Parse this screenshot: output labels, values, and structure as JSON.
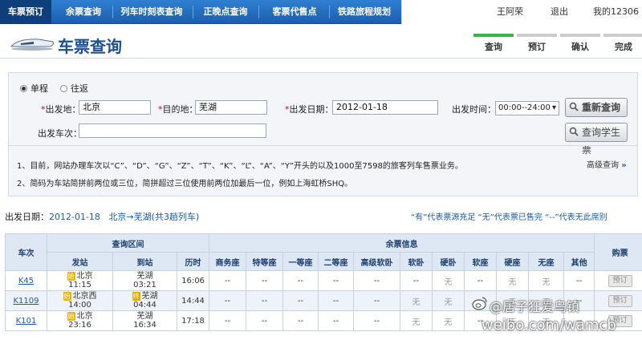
{
  "nav": {
    "items": [
      "车票预订",
      "余票查询",
      "列车时刻表查询",
      "正晚点查询",
      "客票代售点",
      "铁路旅程规划"
    ],
    "user_name": "王阿荣",
    "logout": "退出",
    "my12306": "我的12306"
  },
  "header": {
    "title": "车票查询",
    "steps": [
      "查询",
      "预订",
      "确认",
      "完成"
    ]
  },
  "form": {
    "trip_oneway": "单程",
    "trip_round": "往返",
    "from_label": "出发地：",
    "from_value": "北京",
    "to_label": "目的地：",
    "to_value": "芜湖",
    "date_label": "出发日期：",
    "date_value": "2012-01-18",
    "time_label": "出发时间：",
    "time_value": "00:00--24:00",
    "train_label": "出发车次：",
    "train_value": "",
    "required_mark": "*",
    "search_button": "重新查询",
    "student_button": "查询学生票",
    "notes": [
      "1、目前，网站办理车次以“C”、“D”、“G”、“Z”、“T”、“K”、“L”、“A”、“Y”开头的以及1000至7598的旅客列车售票业务。",
      "2、简码为车站简拼前两位或三位，简拼超过三位使用前两位加最后一位，例如上海虹桥SHQ。"
    ],
    "advanced": "高级查询"
  },
  "summary": {
    "date_label": "出发日期：",
    "date": "2012-01-18",
    "route": "北京→芜湖(共",
    "count": "3",
    "suffix": "趟列车)",
    "legend": "“有”代表票源充足  “无”代表票已售完  “--”代表无此席别"
  },
  "table": {
    "header_train": "车次",
    "header_interval": "查询区间",
    "header_seats": "余票信息",
    "header_book": "购票",
    "sub_headers": [
      "发站",
      "到站",
      "历时",
      "商务座",
      "特等座",
      "一等座",
      "二等座",
      "高级软卧",
      "软卧",
      "硬卧",
      "软座",
      "硬座",
      "无座",
      "其他"
    ],
    "rows": [
      {
        "train": "K45",
        "from_tag": "始",
        "from": "北京",
        "dep": "11:15",
        "to_tag": "",
        "to": "芜湖",
        "arr": "03:21",
        "duration": "16:06",
        "seats": [
          "--",
          "--",
          "--",
          "--",
          "--",
          "--",
          "无",
          "--",
          "无",
          "无",
          "--"
        ],
        "book": "预订"
      },
      {
        "train": "K1109",
        "from_tag": "始",
        "from": "北京西",
        "dep": "14:00",
        "to_tag": "终",
        "to": "芜湖",
        "arr": "04:44",
        "duration": "14:44",
        "seats": [
          "--",
          "--",
          "--",
          "--",
          "--",
          "无",
          "无",
          "--",
          "无",
          "无",
          "--"
        ],
        "book": "预订"
      },
      {
        "train": "K101",
        "from_tag": "始",
        "from": "北京",
        "dep": "23:16",
        "to_tag": "",
        "to": "芜湖",
        "arr": "16:34",
        "duration": "17:18",
        "seats": [
          "--",
          "--",
          "--",
          "--",
          "--",
          "无",
          "无",
          "--",
          "无",
          "无",
          "--"
        ],
        "book": "预订"
      }
    ]
  },
  "watermark": {
    "line1": "@居子狂爱乌镇",
    "line2": "weibo.com/wamcb"
  }
}
